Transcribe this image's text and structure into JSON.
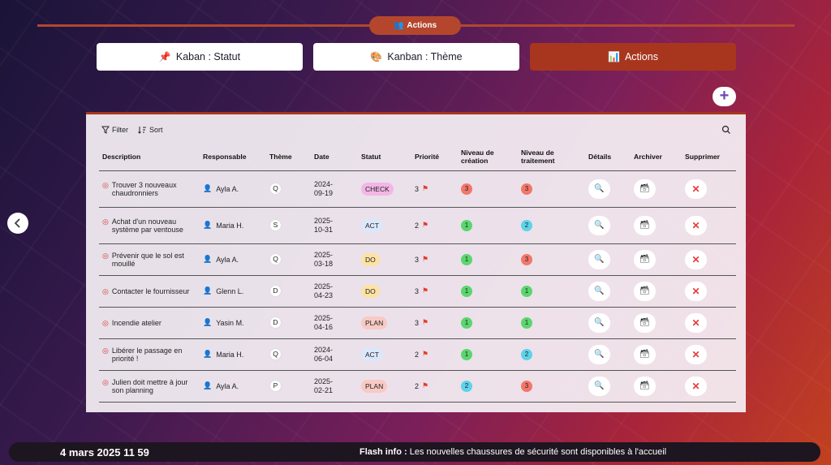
{
  "header": {
    "pill_label": "Actions"
  },
  "tabs": [
    {
      "icon": "📌",
      "label": "Kaban : Statut"
    },
    {
      "icon": "🎨",
      "label": "Kanban : Thème"
    },
    {
      "icon": "📊",
      "label": "Actions"
    }
  ],
  "add_button_label": "+",
  "toolbar": {
    "filter_label": "Filter",
    "sort_label": "Sort"
  },
  "columns": [
    "Description",
    "Responsable",
    "Thème",
    "Date",
    "Statut",
    "Priorité",
    "Niveau de création",
    "Niveau de traitement",
    "Détails",
    "Archiver",
    "Supprimer"
  ],
  "rows": [
    {
      "description": "Trouver 3 nouveaux chaudronniers",
      "responsable": "Ayla A.",
      "theme": "Q",
      "date": "2024-09-19",
      "statut": "CHECK",
      "priorite": "3",
      "creation": "3",
      "traitement": "3"
    },
    {
      "description": "Achat d'un nouveau système par ventouse",
      "responsable": "Maria H.",
      "theme": "S",
      "date": "2025-10-31",
      "statut": "ACT",
      "priorite": "2",
      "creation": "1",
      "traitement": "2"
    },
    {
      "description": "Prévenir que le sol est mouillé",
      "responsable": "Ayla A.",
      "theme": "Q",
      "date": "2025-03-18",
      "statut": "DO",
      "priorite": "3",
      "creation": "1",
      "traitement": "3"
    },
    {
      "description": "Contacter le fournisseur",
      "responsable": "Glenn L.",
      "theme": "D",
      "date": "2025-04-23",
      "statut": "DO",
      "priorite": "3",
      "creation": "1",
      "traitement": "1"
    },
    {
      "description": "Incendie atelier",
      "responsable": "Yasin M.",
      "theme": "D",
      "date": "2025-04-16",
      "statut": "PLAN",
      "priorite": "3",
      "creation": "1",
      "traitement": "1"
    },
    {
      "description": "Libérer le passage en priorité !",
      "responsable": "Maria H.",
      "theme": "Q",
      "date": "2024-06-04",
      "statut": "ACT",
      "priorite": "2",
      "creation": "1",
      "traitement": "2"
    },
    {
      "description": "Julien doit mettre à jour son planning",
      "responsable": "Ayla A.",
      "theme": "P",
      "date": "2025-02-21",
      "statut": "PLAN",
      "priorite": "2",
      "creation": "2",
      "traitement": "3"
    }
  ],
  "status_colors": {
    "CHECK": "#f3b6e6",
    "ACT": "#dbe7fb",
    "DO": "#fde2a3",
    "PLAN": "#f9c9c3"
  },
  "level_colors": {
    "1": "#5bd66f",
    "2": "#5ed3ea",
    "3": "#f2776a"
  },
  "icons": {
    "details": "magnifier-icon",
    "archive": "archive-box-icon",
    "delete": "close-icon"
  },
  "footer": {
    "datetime": "4 mars 2025 11 59",
    "flash_label": "Flash info :",
    "flash_text": " Les nouvelles chaussures de sécurité sont disponibles à l'accueil"
  }
}
